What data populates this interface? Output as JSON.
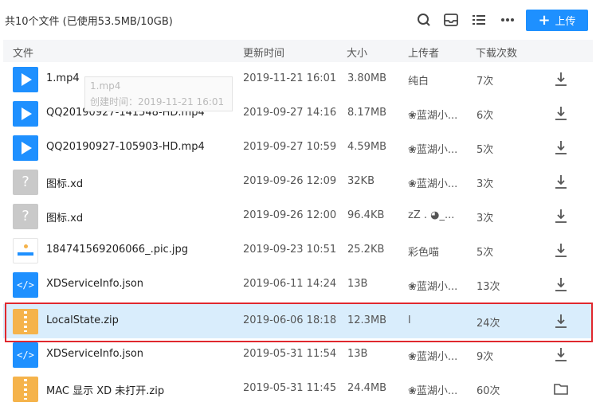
{
  "topbar": {
    "summary": "共10个文件 (已使用53.5MB/10GB)",
    "upload_label": "上传"
  },
  "columns": {
    "file": "文件",
    "time": "更新时间",
    "size": "大小",
    "uploader": "上传者",
    "downloads": "下载次数"
  },
  "tooltip": {
    "name": "1.mp4",
    "created": "创建时间：2019-11-21 16:01"
  },
  "files": [
    {
      "name": "1.mp4",
      "time": "2019-11-21 16:01",
      "size": "3.80MB",
      "uploader": "纯白",
      "downloads": "7次",
      "type": "video-icon",
      "action": "download-icon"
    },
    {
      "name": "QQ20190927-141548-HD.mp4",
      "time": "2019-09-27 14:16",
      "size": "8.17MB",
      "uploader": "❀蓝湖小...",
      "downloads": "6次",
      "type": "video-icon",
      "action": "download-icon"
    },
    {
      "name": "QQ20190927-105903-HD.mp4",
      "time": "2019-09-27 10:59",
      "size": "4.59MB",
      "uploader": "❀蓝湖小...",
      "downloads": "5次",
      "type": "video-icon",
      "action": "download-icon"
    },
    {
      "name": "图标.xd",
      "time": "2019-09-26 12:09",
      "size": "32KB",
      "uploader": "❀蓝湖小...",
      "downloads": "3次",
      "type": "unknown-file-icon",
      "action": "download-icon"
    },
    {
      "name": "图标.xd",
      "time": "2019-09-26 12:00",
      "size": "96.4KB",
      "uploader": "zZ . ◕_...",
      "downloads": "3次",
      "type": "unknown-file-icon",
      "action": "download-icon"
    },
    {
      "name": "184741569206066_.pic.jpg",
      "time": "2019-09-23 10:51",
      "size": "25.2KB",
      "uploader": "彩色喵",
      "downloads": "5次",
      "type": "image-icon",
      "action": "download-icon"
    },
    {
      "name": "XDServiceInfo.json",
      "time": "2019-06-11 14:24",
      "size": "13B",
      "uploader": "❀蓝湖小...",
      "downloads": "13次",
      "type": "code-file-icon",
      "action": "download-icon"
    },
    {
      "name": "LocalState.zip",
      "time": "2019-06-06 18:18",
      "size": "12.3MB",
      "uploader": "l",
      "downloads": "24次",
      "type": "zip-icon",
      "action": "download-icon",
      "selected": true
    },
    {
      "name": "XDServiceInfo.json",
      "time": "2019-05-31 11:54",
      "size": "13B",
      "uploader": "❀蓝湖小...",
      "downloads": "9次",
      "type": "code-file-icon",
      "action": "download-icon"
    },
    {
      "name": "MAC 显示 XD 未打开.zip",
      "time": "2019-05-31 11:45",
      "size": "24.4MB",
      "uploader": "❀蓝湖小...",
      "downloads": "60次",
      "type": "zip-icon",
      "action": "folder-icon"
    }
  ],
  "colors": {
    "accent": "#1e90ff",
    "selected_row": "#d9edfc",
    "highlight_border": "#e0282e",
    "zip": "#f5b34b"
  }
}
